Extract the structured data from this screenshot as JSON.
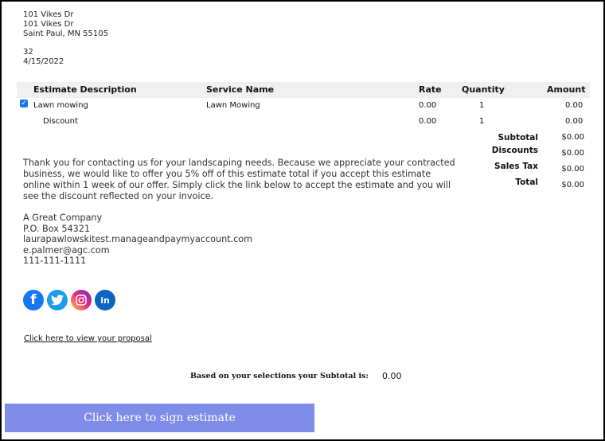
{
  "address": {
    "line1": "101 Vikes Dr",
    "line2": "101 Vikes Dr",
    "city_state_zip": "Saint Paul, MN 55105"
  },
  "estimate_meta": {
    "number": "32",
    "date": "4/15/2022"
  },
  "table": {
    "headers": {
      "description": "Estimate Description",
      "service": "Service Name",
      "rate": "Rate",
      "quantity": "Quantity",
      "amount": "Amount"
    },
    "rows": [
      {
        "checked": true,
        "description": "Lawn mowing",
        "service": "Lawn Mowing",
        "rate": "0.00",
        "quantity": "1",
        "amount": "0.00"
      },
      {
        "checked": false,
        "description": "Discount",
        "service": "",
        "rate": "0.00",
        "quantity": "1",
        "amount": "0.00"
      }
    ]
  },
  "summary": {
    "subtotal_label": "Subtotal",
    "subtotal_value": "$0.00",
    "discounts_label": "Discounts",
    "discounts_value": "$0.00",
    "sales_tax_label": "Sales Tax",
    "sales_tax_value": "$0.00",
    "total_label": "Total",
    "total_value": "$0.00"
  },
  "message": "Thank you for contacting us for your landscaping needs. Because we appreciate your contracted business, we would like to offer you 5% off of this estimate total if you accept this estimate online within 1 week of our offer. Simply click the link below to accept the estimate and you will see the discount reflected on your invoice.",
  "company": {
    "name": "A Great Company",
    "po_box": "P.O. Box 54321",
    "website": "laurapawlowskitest.manageandpaymyaccount.com",
    "email": "e.palmer@agc.com",
    "phone": "111-111-1111"
  },
  "social": [
    {
      "icon": "facebook-icon",
      "glyph": "f",
      "color": "#1877f2"
    },
    {
      "icon": "twitter-icon",
      "glyph": "t",
      "color": "#1d9bf0"
    },
    {
      "icon": "instagram-icon",
      "glyph": "◎",
      "color": "#ee2a7b"
    },
    {
      "icon": "linkedin-icon",
      "glyph": "in",
      "color": "#0a66c2"
    }
  ],
  "proposal_link": "Click here to view your proposal",
  "selection_subtotal": {
    "label": "Based on your selections your Subtotal is:",
    "value": "0.00"
  },
  "sign_button": "Click here to sign estimate",
  "colors": {
    "sign_button_bg": "#7f8ce8",
    "table_header_bg": "#f0f0f0",
    "checkbox": "#1a73e8"
  }
}
